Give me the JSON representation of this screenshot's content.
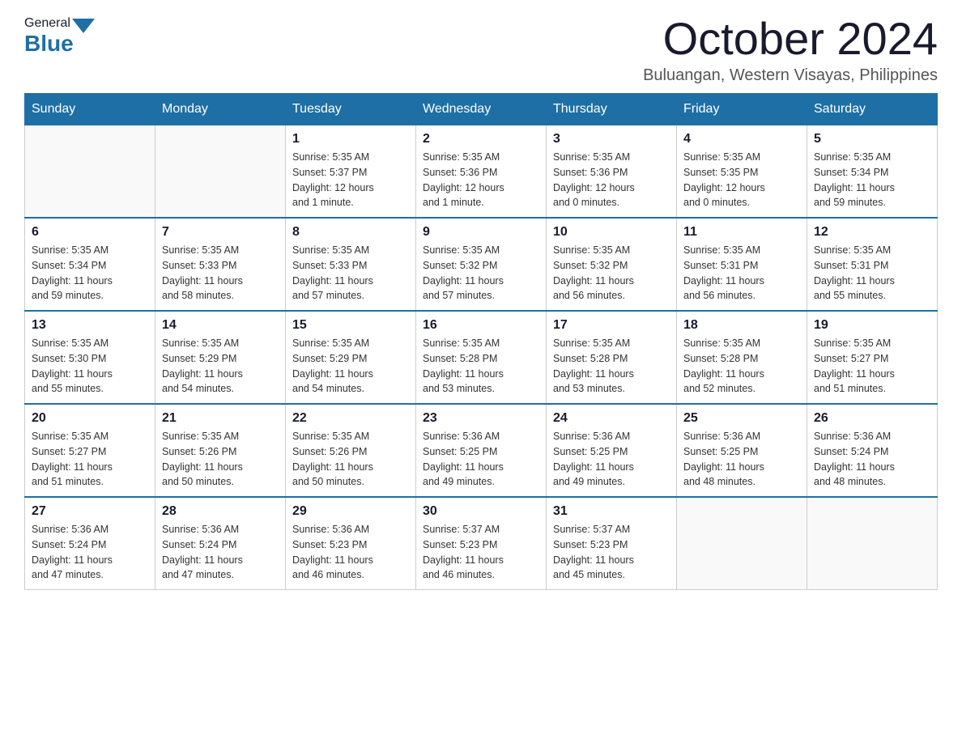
{
  "header": {
    "logo_general": "General",
    "logo_blue": "Blue",
    "month_title": "October 2024",
    "location": "Buluangan, Western Visayas, Philippines"
  },
  "columns": [
    "Sunday",
    "Monday",
    "Tuesday",
    "Wednesday",
    "Thursday",
    "Friday",
    "Saturday"
  ],
  "weeks": [
    [
      {
        "day": "",
        "info": ""
      },
      {
        "day": "",
        "info": ""
      },
      {
        "day": "1",
        "info": "Sunrise: 5:35 AM\nSunset: 5:37 PM\nDaylight: 12 hours\nand 1 minute."
      },
      {
        "day": "2",
        "info": "Sunrise: 5:35 AM\nSunset: 5:36 PM\nDaylight: 12 hours\nand 1 minute."
      },
      {
        "day": "3",
        "info": "Sunrise: 5:35 AM\nSunset: 5:36 PM\nDaylight: 12 hours\nand 0 minutes."
      },
      {
        "day": "4",
        "info": "Sunrise: 5:35 AM\nSunset: 5:35 PM\nDaylight: 12 hours\nand 0 minutes."
      },
      {
        "day": "5",
        "info": "Sunrise: 5:35 AM\nSunset: 5:34 PM\nDaylight: 11 hours\nand 59 minutes."
      }
    ],
    [
      {
        "day": "6",
        "info": "Sunrise: 5:35 AM\nSunset: 5:34 PM\nDaylight: 11 hours\nand 59 minutes."
      },
      {
        "day": "7",
        "info": "Sunrise: 5:35 AM\nSunset: 5:33 PM\nDaylight: 11 hours\nand 58 minutes."
      },
      {
        "day": "8",
        "info": "Sunrise: 5:35 AM\nSunset: 5:33 PM\nDaylight: 11 hours\nand 57 minutes."
      },
      {
        "day": "9",
        "info": "Sunrise: 5:35 AM\nSunset: 5:32 PM\nDaylight: 11 hours\nand 57 minutes."
      },
      {
        "day": "10",
        "info": "Sunrise: 5:35 AM\nSunset: 5:32 PM\nDaylight: 11 hours\nand 56 minutes."
      },
      {
        "day": "11",
        "info": "Sunrise: 5:35 AM\nSunset: 5:31 PM\nDaylight: 11 hours\nand 56 minutes."
      },
      {
        "day": "12",
        "info": "Sunrise: 5:35 AM\nSunset: 5:31 PM\nDaylight: 11 hours\nand 55 minutes."
      }
    ],
    [
      {
        "day": "13",
        "info": "Sunrise: 5:35 AM\nSunset: 5:30 PM\nDaylight: 11 hours\nand 55 minutes."
      },
      {
        "day": "14",
        "info": "Sunrise: 5:35 AM\nSunset: 5:29 PM\nDaylight: 11 hours\nand 54 minutes."
      },
      {
        "day": "15",
        "info": "Sunrise: 5:35 AM\nSunset: 5:29 PM\nDaylight: 11 hours\nand 54 minutes."
      },
      {
        "day": "16",
        "info": "Sunrise: 5:35 AM\nSunset: 5:28 PM\nDaylight: 11 hours\nand 53 minutes."
      },
      {
        "day": "17",
        "info": "Sunrise: 5:35 AM\nSunset: 5:28 PM\nDaylight: 11 hours\nand 53 minutes."
      },
      {
        "day": "18",
        "info": "Sunrise: 5:35 AM\nSunset: 5:28 PM\nDaylight: 11 hours\nand 52 minutes."
      },
      {
        "day": "19",
        "info": "Sunrise: 5:35 AM\nSunset: 5:27 PM\nDaylight: 11 hours\nand 51 minutes."
      }
    ],
    [
      {
        "day": "20",
        "info": "Sunrise: 5:35 AM\nSunset: 5:27 PM\nDaylight: 11 hours\nand 51 minutes."
      },
      {
        "day": "21",
        "info": "Sunrise: 5:35 AM\nSunset: 5:26 PM\nDaylight: 11 hours\nand 50 minutes."
      },
      {
        "day": "22",
        "info": "Sunrise: 5:35 AM\nSunset: 5:26 PM\nDaylight: 11 hours\nand 50 minutes."
      },
      {
        "day": "23",
        "info": "Sunrise: 5:36 AM\nSunset: 5:25 PM\nDaylight: 11 hours\nand 49 minutes."
      },
      {
        "day": "24",
        "info": "Sunrise: 5:36 AM\nSunset: 5:25 PM\nDaylight: 11 hours\nand 49 minutes."
      },
      {
        "day": "25",
        "info": "Sunrise: 5:36 AM\nSunset: 5:25 PM\nDaylight: 11 hours\nand 48 minutes."
      },
      {
        "day": "26",
        "info": "Sunrise: 5:36 AM\nSunset: 5:24 PM\nDaylight: 11 hours\nand 48 minutes."
      }
    ],
    [
      {
        "day": "27",
        "info": "Sunrise: 5:36 AM\nSunset: 5:24 PM\nDaylight: 11 hours\nand 47 minutes."
      },
      {
        "day": "28",
        "info": "Sunrise: 5:36 AM\nSunset: 5:24 PM\nDaylight: 11 hours\nand 47 minutes."
      },
      {
        "day": "29",
        "info": "Sunrise: 5:36 AM\nSunset: 5:23 PM\nDaylight: 11 hours\nand 46 minutes."
      },
      {
        "day": "30",
        "info": "Sunrise: 5:37 AM\nSunset: 5:23 PM\nDaylight: 11 hours\nand 46 minutes."
      },
      {
        "day": "31",
        "info": "Sunrise: 5:37 AM\nSunset: 5:23 PM\nDaylight: 11 hours\nand 45 minutes."
      },
      {
        "day": "",
        "info": ""
      },
      {
        "day": "",
        "info": ""
      }
    ]
  ]
}
